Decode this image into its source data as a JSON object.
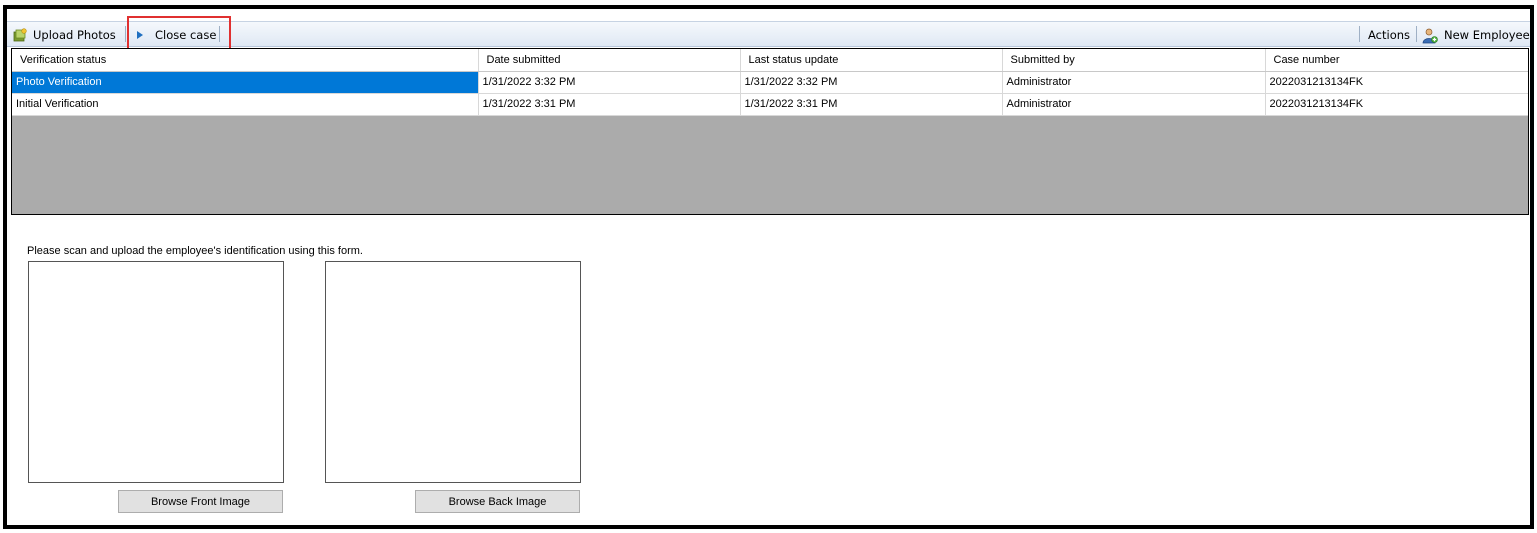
{
  "toolbar": {
    "upload_photos": "Upload Photos",
    "close_case": "Close case",
    "actions": "Actions",
    "new_employee": "New Employee"
  },
  "grid": {
    "columns": [
      "Verification status",
      "Date submitted",
      "Last status update",
      "Submitted by",
      "Case number"
    ],
    "rows": [
      [
        "Photo Verification",
        "1/31/2022 3:32 PM",
        "1/31/2022 3:32 PM",
        "Administrator",
        "2022031213134FK"
      ],
      [
        "Initial Verification",
        "1/31/2022 3:31 PM",
        "1/31/2022 3:31 PM",
        "Administrator",
        "2022031213134FK"
      ]
    ],
    "selected_row": 0
  },
  "form": {
    "instruction": "Please scan and upload the employee's identification using this form.",
    "browse_front": "Browse Front Image",
    "browse_back": "Browse Back Image"
  },
  "colors": {
    "selection": "#0078d7",
    "highlight": "#e03030",
    "grid_empty": "#ababab"
  },
  "icons": {
    "upload": "upload-photos-icon",
    "close": "play-arrow-icon",
    "employee": "new-employee-icon"
  }
}
